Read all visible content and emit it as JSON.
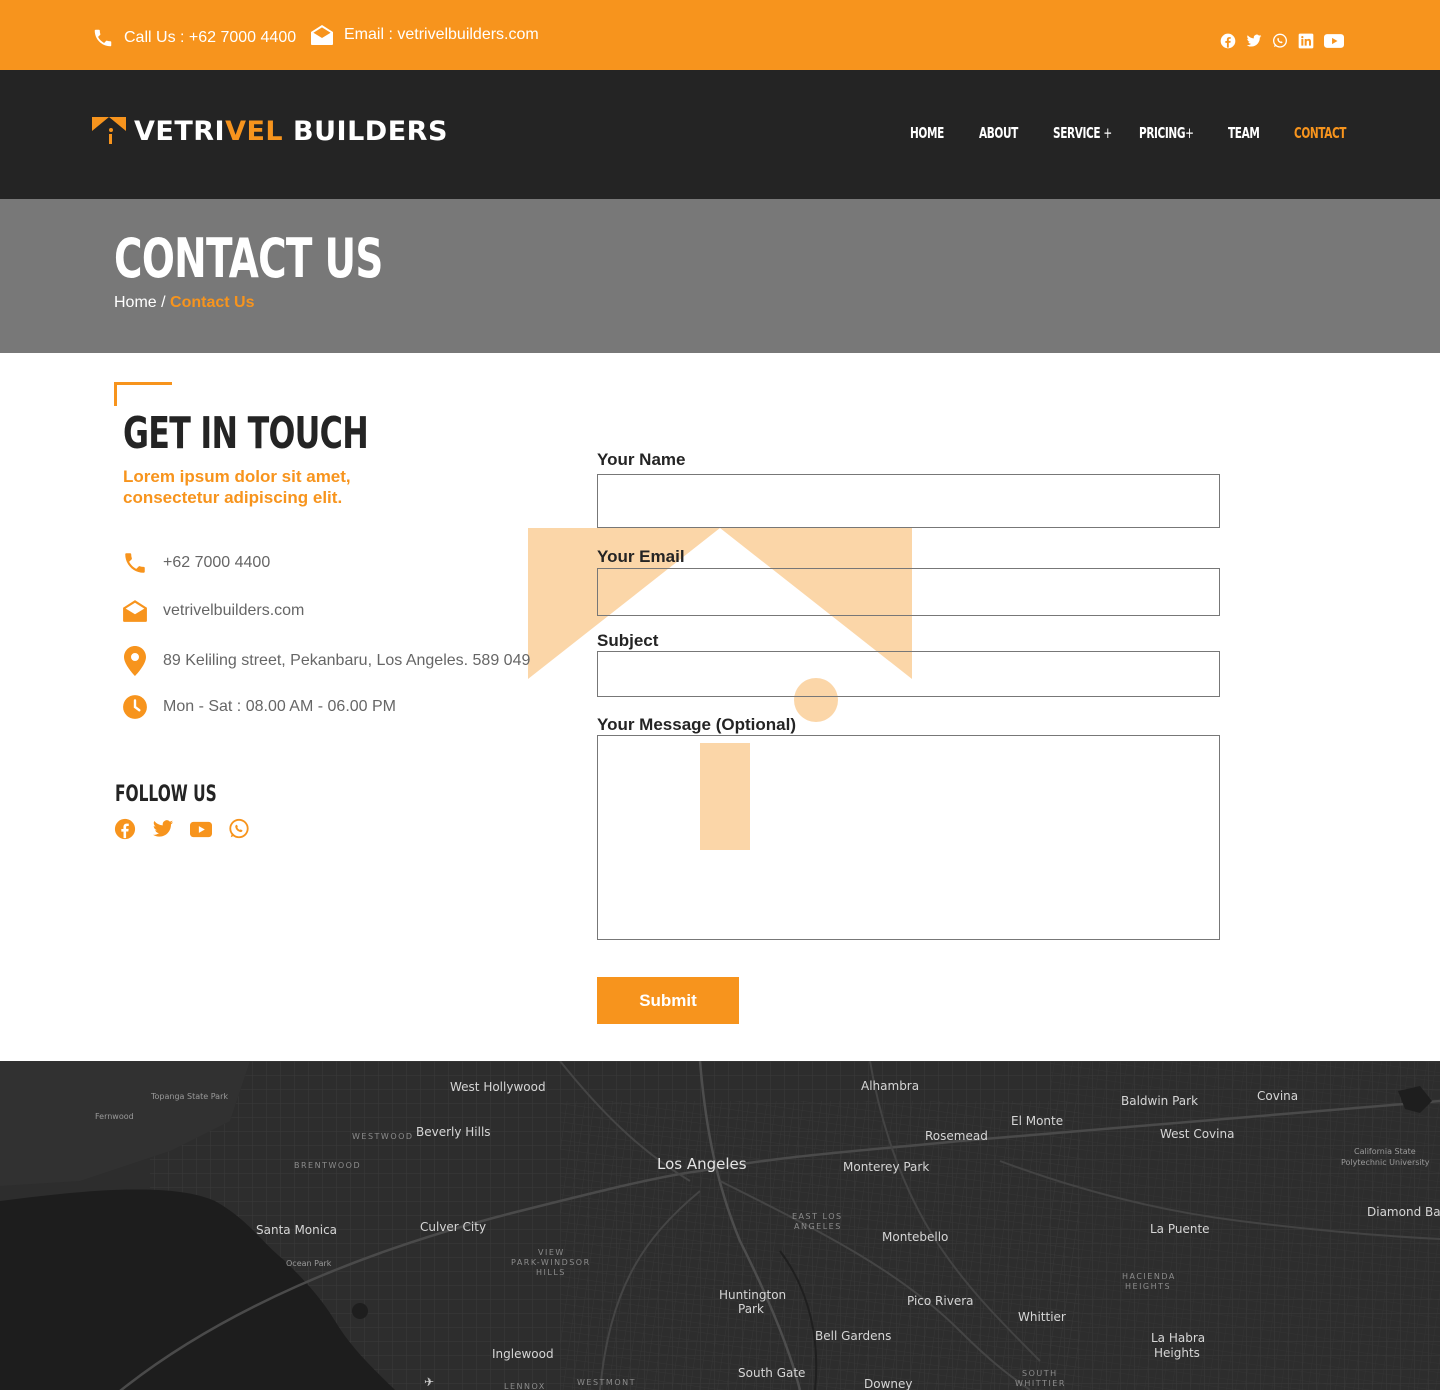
{
  "topbar": {
    "phone_text": "Call Us : +62 7000 4400",
    "email_text": "Email : vetrivelbuilders.com",
    "socials": [
      "facebook-icon",
      "twitter-icon",
      "whatsapp-icon",
      "linkedin-icon",
      "youtube-icon"
    ]
  },
  "header": {
    "logo": {
      "part1": "VETRI",
      "part2": "VEL",
      "part3": " BUILDERS"
    },
    "nav": [
      {
        "label": "HOME"
      },
      {
        "label": "ABOUT"
      },
      {
        "label": "SERVICE",
        "suffix": "+"
      },
      {
        "label": "PRICING",
        "suffix": "+"
      },
      {
        "label": "TEAM"
      },
      {
        "label": "CONTACT",
        "active": true
      }
    ]
  },
  "hero": {
    "title": "CONTACT US",
    "breadcrumb_home": "Home",
    "breadcrumb_sep": "/",
    "breadcrumb_current": "Contact Us"
  },
  "contact": {
    "heading": "GET IN TOUCH",
    "subtitle": "Lorem ipsum dolor sit amet, consectetur adipiscing elit.",
    "phone": "+62 7000 4400",
    "email": "vetrivelbuilders.com",
    "address": "89 Keliling street, Pekanbaru, Los Angeles. 589 049",
    "hours": "Mon - Sat : 08.00 AM - 06.00 PM",
    "follow_title": "FOLLOW US",
    "follow_icons": [
      "facebook-icon",
      "twitter-icon",
      "youtube-icon",
      "whatsapp-icon"
    ]
  },
  "form": {
    "name_label": "Your Name",
    "name_value": "",
    "email_label": "Your Email",
    "email_value": "",
    "subject_label": "Subject",
    "subject_value": "",
    "message_label": "Your Message (Optional)",
    "message_value": "",
    "submit_label": "Submit"
  },
  "map": {
    "labels": {
      "west_hollywood": "West Hollywood",
      "alhambra": "Alhambra",
      "baldwin_park": "Baldwin Park",
      "covina": "Covina",
      "topanga": "Topanga State Park",
      "fernwood": "Fernwood",
      "westwood": "WESTWOOD",
      "beverly_hills": "Beverly Hills",
      "el_monte": "El Monte",
      "rosemead": "Rosemead",
      "west_covina": "West Covina",
      "cal_poly_1": "California State",
      "cal_poly_2": "Polytechnic University",
      "brentwood": "BRENTWOOD",
      "los_angeles": "Los Angeles",
      "monterey_park": "Monterey Park",
      "diamond_bar": "Diamond Bar",
      "east_la_1": "EAST LOS",
      "east_la_2": "ANGELES",
      "santa_monica": "Santa Monica",
      "culver_city": "Culver City",
      "montebello": "Montebello",
      "la_puente": "La Puente",
      "ocean_park": "Ocean Park",
      "view_park_1": "VIEW",
      "view_park_2": "PARK-WINDSOR",
      "view_park_3": "HILLS",
      "hacienda_1": "HACIENDA",
      "hacienda_2": "HEIGHTS",
      "huntington_1": "Huntington",
      "huntington_2": "Park",
      "pico_rivera": "Pico Rivera",
      "whittier": "Whittier",
      "la_habra_1": "La Habra",
      "la_habra_2": "Heights",
      "bell_gardens": "Bell Gardens",
      "inglewood": "Inglewood",
      "south_gate": "South Gate",
      "downey": "Downey",
      "south_whittier_1": "SOUTH",
      "south_whittier_2": "WHITTIER",
      "westmont": "WESTMONT",
      "lennox": "LENNOX"
    }
  }
}
